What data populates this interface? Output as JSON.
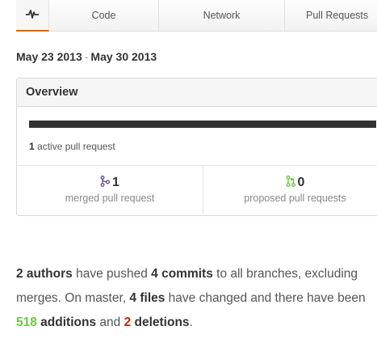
{
  "tabs": [
    {
      "label": "",
      "icon": "pulse-icon",
      "active": true
    },
    {
      "label": "Code"
    },
    {
      "label": "Network"
    },
    {
      "label": "Pull Requests"
    }
  ],
  "date_range": {
    "start": "May 23 2013",
    "separator": "-",
    "end": "May 30 2013"
  },
  "overview": {
    "title": "Overview",
    "progress_fraction": 1.0,
    "progress_color": "#333333",
    "active_count": "1",
    "active_label": "active pull request",
    "merged": {
      "count": "1",
      "label": "merged pull request",
      "icon": "git-merge-icon",
      "color": "#6e5494"
    },
    "proposed": {
      "count": "0",
      "label": "proposed pull requests",
      "icon": "git-pull-request-icon",
      "color": "#6cc644"
    }
  },
  "summary": {
    "authors": "2 authors",
    "t1": " have pushed ",
    "commits": "4 commits",
    "t2": " to all branches, excluding merges. On master, ",
    "files": "4 files",
    "t3": " have changed and there have been ",
    "additions_count": "518",
    "additions_word": " additions",
    "t4": " and ",
    "deletions_count": "2",
    "deletions_word": " deletions",
    "t5": "."
  }
}
